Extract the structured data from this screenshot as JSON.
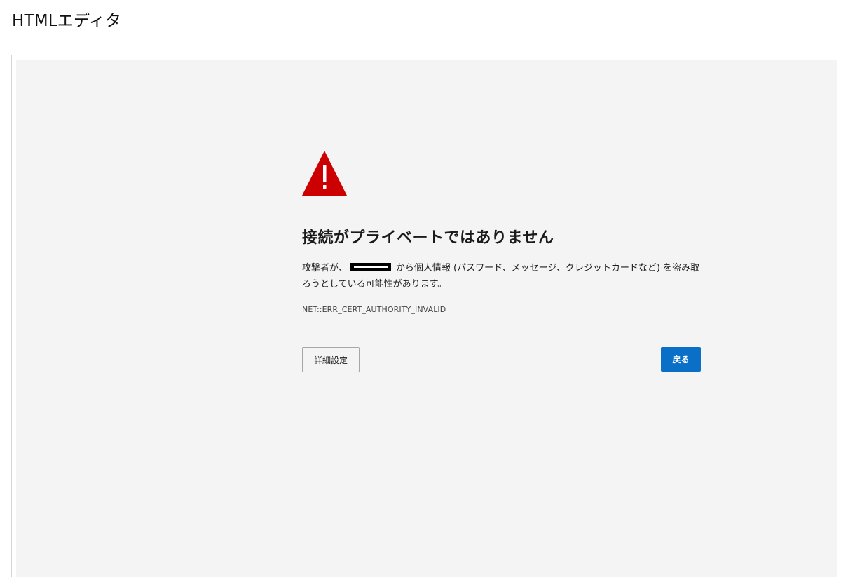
{
  "app": {
    "title": "HTMLエディタ"
  },
  "error_page": {
    "icon": "warning-triangle-icon",
    "icon_color": "#cc0000",
    "heading": "接続がプライベートではありません",
    "message_prefix": "攻撃者が、",
    "message_suffix": " から個人情報 (パスワード、メッセージ、クレジットカードなど) を盗み取ろうとしている可能性があります。",
    "error_code": "NET::ERR_CERT_AUTHORITY_INVALID",
    "advanced_button_label": "詳細設定",
    "back_button_label": "戻る",
    "accent_color": "#0a6fc7",
    "background_color": "#f4f4f4"
  }
}
